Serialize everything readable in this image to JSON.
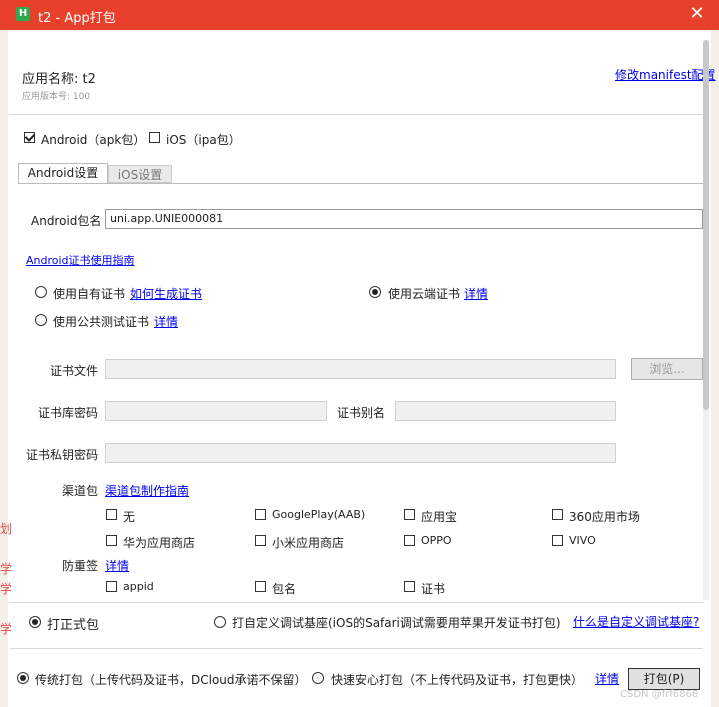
{
  "window": {
    "title": "t2 - App打包",
    "app_icon": "H"
  },
  "app": {
    "name_line": "应用名称: t2",
    "version_line": "应用版本号: 100",
    "manifest_link": "修改manifest配置"
  },
  "platforms": {
    "android": {
      "label": "Android（apk包）",
      "checked": true
    },
    "ios": {
      "label": "iOS（ipa包）",
      "checked": false
    }
  },
  "tabs": [
    {
      "label": "Android设置",
      "active": true
    },
    {
      "label": "iOS设置",
      "active": false
    }
  ],
  "android": {
    "package_label": "Android包名",
    "package_value": "uni.app.UNIE000081",
    "cert_guide_link": "Android证书使用指南",
    "cert_options": {
      "own": {
        "label": "使用自有证书",
        "link": "如何生成证书"
      },
      "cloud": {
        "label": "使用云端证书",
        "link": "详情"
      },
      "public": {
        "label": "使用公共测试证书",
        "link": "详情"
      }
    },
    "cert_file_label": "证书文件",
    "browse_button": "浏览...",
    "keystore_pwd_label": "证书库密码",
    "alias_label": "证书别名",
    "key_pwd_label": "证书私钥密码",
    "channel_label": "渠道包",
    "channel_link": "渠道包制作指南",
    "channels": [
      "无",
      "GooglePlay(AAB)",
      "应用宝",
      "360应用市场",
      "华为应用商店",
      "小米应用商店",
      "OPPO",
      "VIVO"
    ],
    "anti_resign_label": "防重签",
    "anti_resign_link": "详情",
    "anti_resign_options": [
      "appid",
      "包名",
      "证书"
    ]
  },
  "build_type": {
    "formal": {
      "label": "打正式包",
      "selected": true
    },
    "custom": {
      "label": "打自定义调试基座(iOS的Safari调试需要用苹果开发证书打包)",
      "selected": false
    },
    "custom_link": "什么是自定义调试基座?"
  },
  "pack_mode": {
    "traditional": {
      "label": "传统打包（上传代码及证书，DCloud承诺不保留）",
      "selected": true
    },
    "fast": {
      "label": "快速安心打包（不上传代码及证书，打包更快）",
      "selected": false
    },
    "detail_link": "详情",
    "pack_button": "打包(P)"
  },
  "bg_fragments": {
    "left1": "划",
    "left2": "学",
    "watermark": "CSDN @frf6868"
  },
  "colors": {
    "titlebar": "#e8412b",
    "link": "#0000ee"
  }
}
